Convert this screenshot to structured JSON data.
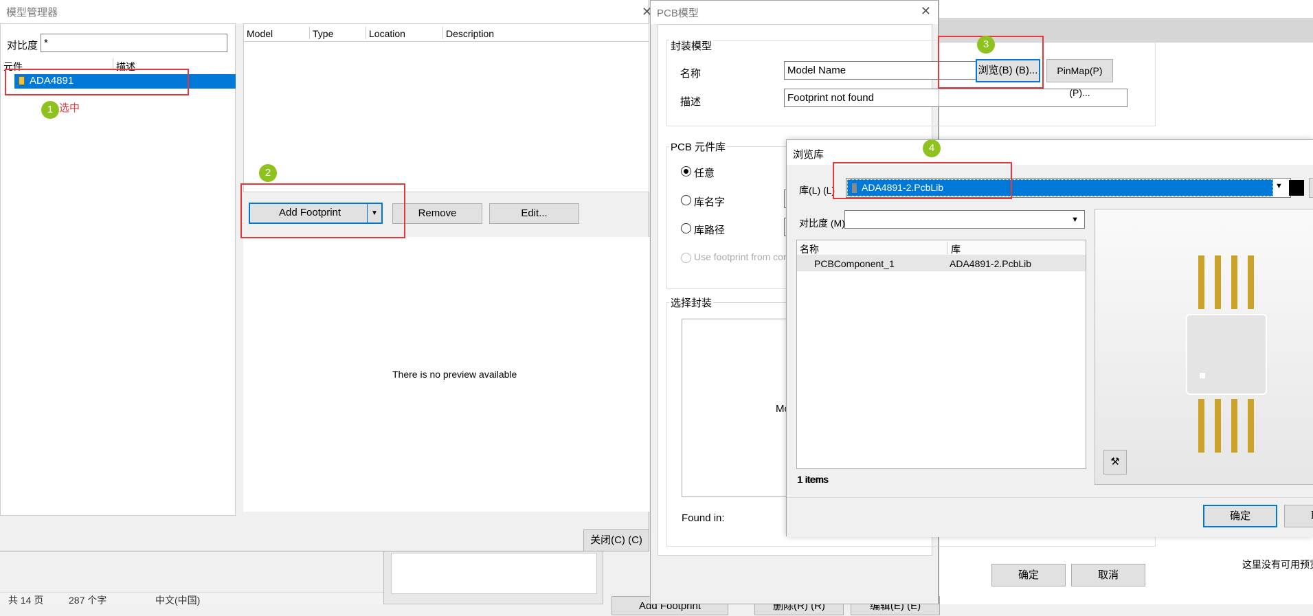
{
  "model_manager": {
    "title": "模型管理器",
    "mask_label": "对比度",
    "mask_value": "*",
    "col_component": "元件",
    "col_desc": "描述",
    "component": "ADA4891",
    "annotation_1": "选中",
    "table_headers": [
      "Model",
      "Type",
      "Location",
      "Description"
    ],
    "add_footprint": "Add Footprint",
    "remove": "Remove",
    "edit": "Edit...",
    "no_preview": "There is no preview available",
    "close": "关闭(C) (C)"
  },
  "pcb_model": {
    "title": "PCB模型",
    "footprint_group": "封装模型",
    "name_label": "名称",
    "name_value": "Model Name",
    "desc_label": "描述",
    "desc_value": "Footprint not found",
    "browse": "浏览(B) (B)...",
    "pinmap": "PinMap(P) (P)...",
    "lib_group": "PCB 元件库",
    "opt_any": "任意",
    "opt_libname": "库名字",
    "opt_libpath": "库路径",
    "opt_use": "Use footprint from com",
    "select_group": "选择封装",
    "model_text": "Mod",
    "found_in": "Found in:",
    "ok": "确定",
    "cancel": "取消"
  },
  "browse_lib": {
    "title": "浏览库",
    "lib_label": "库(L) (L)",
    "lib_value": "ADA4891-2.PcbLib",
    "mask_label": "对比度 (M)",
    "col_name": "名称",
    "col_lib": "库",
    "row_name": "PCBComponent_1",
    "row_lib": "ADA4891-2.PcbLib",
    "items_count": "1 items",
    "ok": "确定",
    "cancel": "取"
  },
  "background": {
    "status_page": "共 14 页",
    "status_words": "287 个字",
    "status_lang": "中文(中国)",
    "bottom_add_footprint": "Add Footprint",
    "bottom_delete": "删除(R) (R)",
    "bottom_edit": "编辑(E) (E)",
    "right_text": "这里没有可用预览"
  },
  "annotations": {
    "n1": "1",
    "n2": "2",
    "n3": "3",
    "n4": "4"
  },
  "colors": {
    "accent": "#0078d7",
    "annotation_red": "#e8373b",
    "badge_green": "#8dc21f",
    "pad_gold": "#c9a227"
  }
}
